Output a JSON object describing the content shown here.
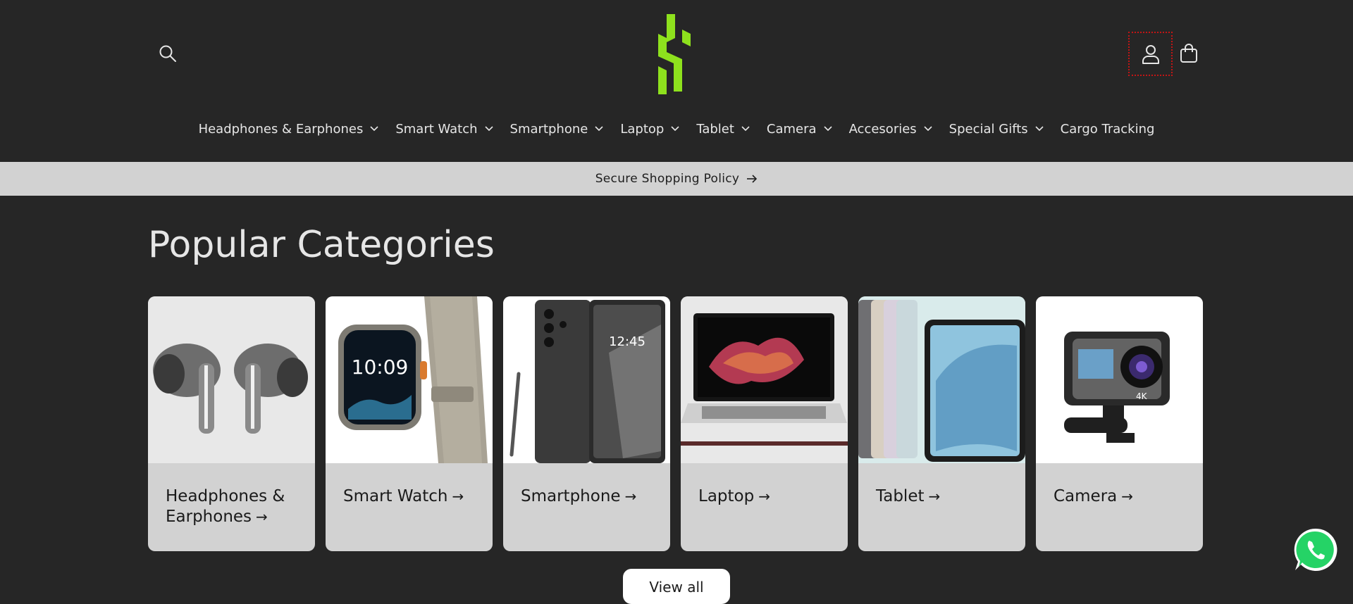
{
  "header": {
    "search_icon": "search-icon",
    "account_icon": "user-icon",
    "cart_icon": "bag-icon",
    "logo_color": "#8ee11d"
  },
  "nav": {
    "items": [
      {
        "label": "Headphones & Earphones",
        "dropdown": true
      },
      {
        "label": "Smart Watch",
        "dropdown": true
      },
      {
        "label": "Smartphone",
        "dropdown": true
      },
      {
        "label": "Laptop",
        "dropdown": true
      },
      {
        "label": "Tablet",
        "dropdown": true
      },
      {
        "label": "Camera",
        "dropdown": true
      },
      {
        "label": "Accesories",
        "dropdown": true
      },
      {
        "label": "Special Gifts",
        "dropdown": true
      },
      {
        "label": "Cargo Tracking",
        "dropdown": false
      }
    ]
  },
  "announcement": {
    "text": "Secure Shopping Policy",
    "icon": "arrow-right-icon"
  },
  "categories": {
    "title": "Popular Categories",
    "cards": [
      {
        "label": "Headphones & Earphones",
        "image": "earbuds"
      },
      {
        "label": "Smart Watch",
        "image": "smartwatch"
      },
      {
        "label": "Smartphone",
        "image": "smartphone"
      },
      {
        "label": "Laptop",
        "image": "laptop"
      },
      {
        "label": "Tablet",
        "image": "tablet"
      },
      {
        "label": "Camera",
        "image": "action-camera"
      }
    ],
    "view_all_label": "View all"
  },
  "colors": {
    "background": "#262626",
    "announcement_bg": "#d2d2d2",
    "card_bg": "#d2d2d2",
    "whatsapp": "#25d366"
  }
}
